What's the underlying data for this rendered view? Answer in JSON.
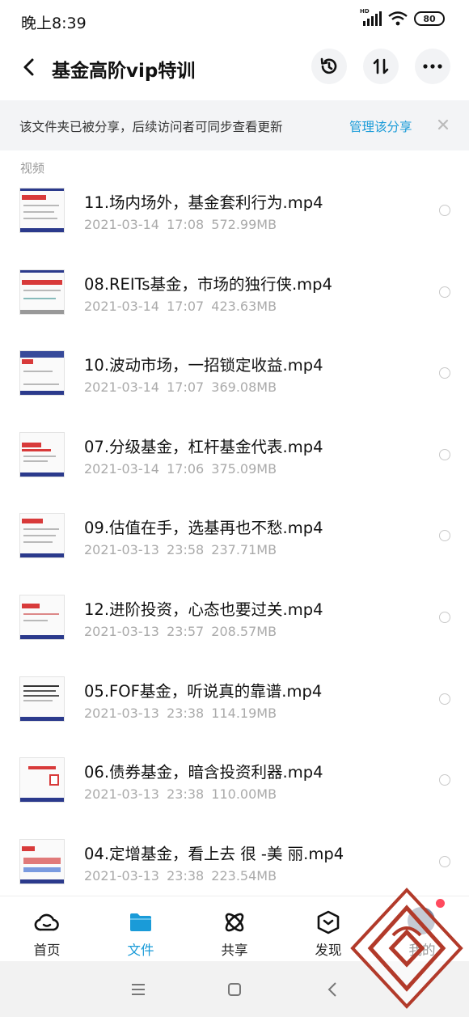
{
  "status_bar": {
    "time": "晚上8:39",
    "network": "HD",
    "battery": "80"
  },
  "header": {
    "title": "基金高阶vip特训",
    "back_icon": "back-arrow-icon",
    "history_icon": "history-icon",
    "sort_icon": "sort-icon",
    "more_icon": "more-icon"
  },
  "share_banner": {
    "text": "该文件夹已被分享，后续访问者可同步查看更新",
    "manage_label": "管理该分享",
    "close_icon": "close-icon"
  },
  "section_label": "视频",
  "files": [
    {
      "name": "11.场内场外，基金套利行为.mp4",
      "date": "2021-03-14",
      "time": "17:08",
      "size": "572.99MB"
    },
    {
      "name": "08.REITs基金，市场的独行侠.mp4",
      "date": "2021-03-14",
      "time": "17:07",
      "size": "423.63MB"
    },
    {
      "name": "10.波动市场，一招锁定收益.mp4",
      "date": "2021-03-14",
      "time": "17:07",
      "size": "369.08MB"
    },
    {
      "name": "07.分级基金，杠杆基金代表.mp4",
      "date": "2021-03-14",
      "time": "17:06",
      "size": "375.09MB"
    },
    {
      "name": "09.估值在手，选基再也不愁.mp4",
      "date": "2021-03-13",
      "time": "23:58",
      "size": "237.71MB"
    },
    {
      "name": "12.进阶投资，心态也要过关.mp4",
      "date": "2021-03-13",
      "time": "23:57",
      "size": "208.57MB"
    },
    {
      "name": "05.FOF基金，听说真的靠谱.mp4",
      "date": "2021-03-13",
      "time": "23:38",
      "size": "114.19MB"
    },
    {
      "name": "06.债券基金，暗含投资利器.mp4",
      "date": "2021-03-13",
      "time": "23:38",
      "size": "110.00MB"
    },
    {
      "name": "04.定增基金，看上去 很 -美 丽.mp4",
      "date": "2021-03-13",
      "time": "23:38",
      "size": "223.54MB"
    }
  ],
  "tabs": [
    {
      "label": "首页",
      "icon": "cloud-icon"
    },
    {
      "label": "文件",
      "icon": "folder-icon",
      "active": true
    },
    {
      "label": "共享",
      "icon": "share-atom-icon"
    },
    {
      "label": "发现",
      "icon": "discover-icon"
    },
    {
      "label": "我的",
      "icon": "avatar"
    }
  ],
  "colors": {
    "accent": "#1a9bd8",
    "badge": "#ff4a5e"
  }
}
